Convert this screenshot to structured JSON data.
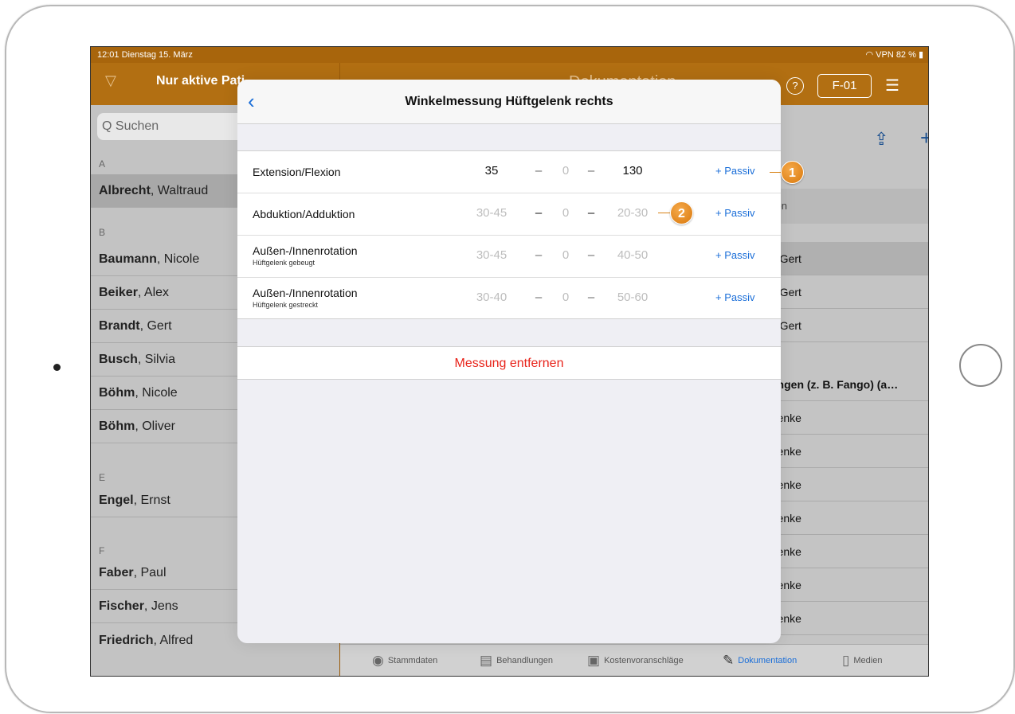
{
  "status": {
    "time_date": "12:01  Dienstag 15. März",
    "right": "◠ VPN 82 % ▮"
  },
  "nav": {
    "filter_icon": "filter-icon",
    "left_title": "Nur aktive Pati",
    "right_title": "Dokumentation",
    "help": "?",
    "patient_button": "F-01",
    "list_icon": "☰"
  },
  "search": {
    "placeholder": "Q Suchen"
  },
  "patients": {
    "sections": [
      "A",
      "B",
      "E",
      "F"
    ],
    "a": [
      {
        "last": "Albrecht",
        "first": ", Waltraud"
      }
    ],
    "b": [
      {
        "last": "Baumann",
        "first": ", Nicole"
      },
      {
        "last": "Beiker",
        "first": ", Alex"
      },
      {
        "last": "Brandt",
        "first": ", Gert"
      },
      {
        "last": "Busch",
        "first": ", Silvia"
      },
      {
        "last": "Böhm",
        "first": ", Nicole"
      },
      {
        "last": "Böhm",
        "first": ", Oliver"
      }
    ],
    "e": [
      {
        "last": "Engel",
        "first": ", Ernst"
      }
    ],
    "f": [
      {
        "last": "Faber",
        "first": ", Paul"
      },
      {
        "last": "Fischer",
        "first": ", Jens"
      },
      {
        "last": "Friedrich",
        "first": ", Alfred"
      }
    ]
  },
  "right": {
    "icons": [
      "share-icon",
      "plus-icon",
      "edit-icon"
    ],
    "header_partial": "von",
    "rows": [
      "n Gert",
      "n Gert",
      "n Gert",
      "ungen (z. B. Fango) (a…",
      "Venke",
      "Venke",
      "Venke",
      "Venke",
      "Venke",
      "Venke",
      "Venke"
    ]
  },
  "tabs": [
    "Stammdaten",
    "Behandlungen",
    "Kostenvoranschläge",
    "Dokumentation",
    "Medien"
  ],
  "modal": {
    "title": "Winkelmessung Hüftgelenk rechts",
    "back_icon": "chevron-left-icon",
    "rows": [
      {
        "label": "Extension/Flexion",
        "sub": "",
        "a": "35",
        "zero": "0",
        "b": "130",
        "filled": true,
        "action": "+ Passiv"
      },
      {
        "label": "Abduktion/Adduktion",
        "sub": "",
        "a": "30-45",
        "zero": "0",
        "b": "20-30",
        "filled": false,
        "action": "+ Passiv"
      },
      {
        "label": "Außen-/Innenrotation",
        "sub": "Hüftgelenk gebeugt",
        "a": "30-45",
        "zero": "0",
        "b": "40-50",
        "filled": false,
        "action": "+ Passiv"
      },
      {
        "label": "Außen-/Innenrotation",
        "sub": "Hüftgelenk gestreckt",
        "a": "30-40",
        "zero": "0",
        "b": "50-60",
        "filled": false,
        "action": "+ Passiv"
      }
    ],
    "dash": "–",
    "remove": "Messung entfernen"
  },
  "callouts": [
    "1",
    "2"
  ]
}
